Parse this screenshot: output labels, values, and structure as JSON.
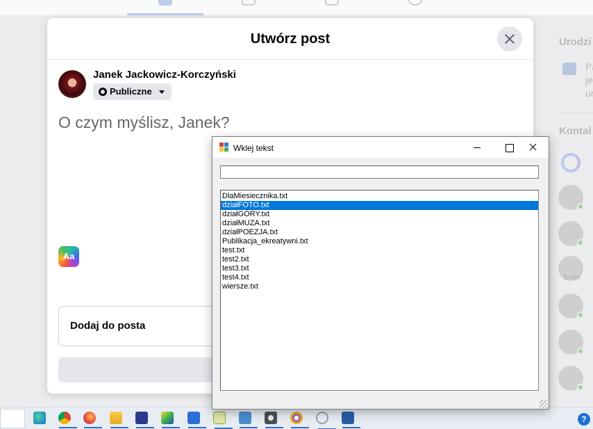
{
  "top_nav": {
    "tabs": [
      {
        "icon": "home-icon",
        "active": true
      },
      {
        "icon": "video-icon",
        "active": false
      },
      {
        "icon": "marketplace-icon",
        "active": false
      },
      {
        "icon": "groups-icon",
        "active": false
      }
    ]
  },
  "right_rail": {
    "birthdays_heading": "Urodzi",
    "birthday_text": [
      "Pa",
      "je",
      "ur"
    ],
    "contacts_heading": "Kontal",
    "contact_time": "5 min",
    "online_color": "#9ed39a"
  },
  "post_dialog": {
    "title": "Utwórz post",
    "user_name": "Janek Jackowicz-Korczyński",
    "audience": "Publiczne",
    "placeholder": "O czym myślisz, Janek?",
    "text_style_button": "Aa",
    "add_to_post": "Dodaj do posta"
  },
  "paste_window": {
    "title": "Wklej tekst",
    "input_value": "",
    "selected_index": 1,
    "accent": "#0078d7",
    "files": [
      "DlaMiesiecznika.txt",
      "działFOTO.txt",
      "działGÓRY.txt",
      "działMUZA.txt",
      "działPOEZJA.txt",
      "Publikacja_ekreatywni.txt",
      "test.txt",
      "test2.txt",
      "test3.txt",
      "test4.txt",
      "wiersze.txt"
    ]
  },
  "taskbar": {
    "icons": [
      "edge-icon",
      "chrome-icon",
      "firefox-icon",
      "file-explorer-icon",
      "floppy-save-icon",
      "image-viewer-icon",
      "word-document-icon",
      "notepad-icon",
      "system-info-icon",
      "settings-gear-icon",
      "chromium-icon",
      "fingerprint-icon",
      "powershell-icon"
    ],
    "help_label": "?"
  }
}
